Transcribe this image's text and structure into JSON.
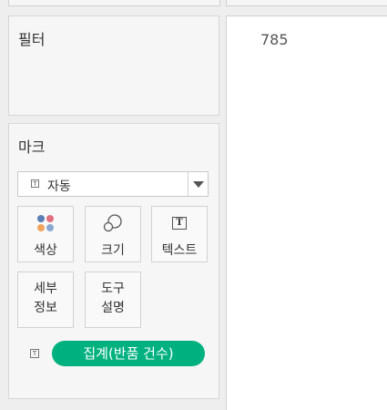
{
  "filters": {
    "title": "필터"
  },
  "marks": {
    "title": "마크",
    "mark_type": {
      "label": "자동",
      "icon": "text-mark-icon"
    },
    "cards": {
      "color": "색상",
      "size": "크기",
      "text": "텍스트",
      "detail_line1": "세부",
      "detail_line2": "정보",
      "tooltip_line1": "도구",
      "tooltip_line2": "설명"
    },
    "field_pill": {
      "label": "집계(반품 건수)",
      "color": "#00b180",
      "icon": "text-mark-icon"
    }
  },
  "view": {
    "value": "785"
  }
}
